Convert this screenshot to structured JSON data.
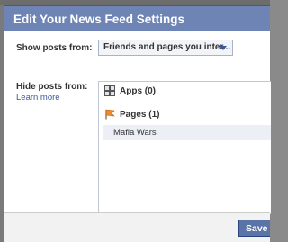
{
  "dialog": {
    "title": "Edit Your News Feed Settings",
    "show_posts": {
      "label": "Show posts from:",
      "selected": "Friends and pages you inter..."
    },
    "hide_posts": {
      "label": "Hide posts from:",
      "learn_more": "Learn more",
      "sections": [
        {
          "icon": "apps-icon",
          "label": "Apps (0)",
          "items": []
        },
        {
          "icon": "flag-icon",
          "label": "Pages (1)",
          "items": [
            "Mafia Wars"
          ]
        }
      ]
    },
    "footer": {
      "save_label": "Save"
    }
  },
  "colors": {
    "title_bar": "#6d84b4",
    "link": "#3b5998",
    "button": "#5b74a8",
    "selected_row": "#eceff5"
  }
}
